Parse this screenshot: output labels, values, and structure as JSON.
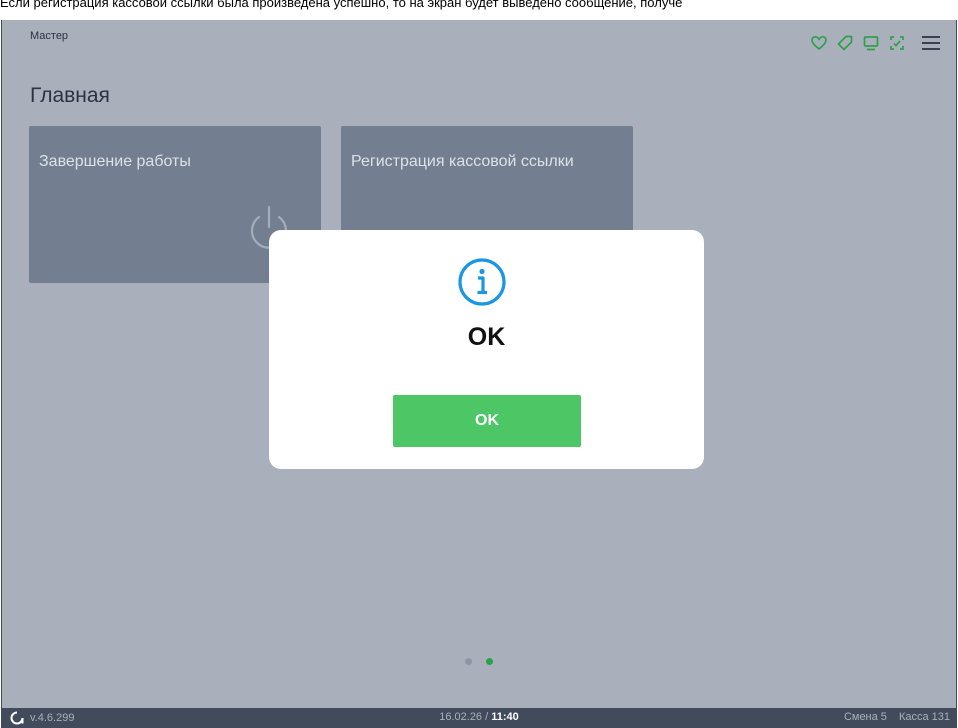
{
  "caption": "Если регистрация кассовой ссылки была произведена успешно, то на экран будет выведено сообщение, получе",
  "header": {
    "mode_label": "Мастер",
    "icons": [
      "heart-icon",
      "tag-icon",
      "monitor-icon",
      "scan-icon",
      "menu-icon"
    ],
    "icon_color": "#2fa04a"
  },
  "page": {
    "title": "Главная",
    "tiles": [
      {
        "label": "Завершение работы",
        "icon": "power-icon"
      },
      {
        "label": "Регистрация кассовой ссылки"
      }
    ],
    "pagination": {
      "total": 2,
      "current": 2
    }
  },
  "dialog": {
    "icon": "info-icon",
    "icon_color": "#1a96e6",
    "message": "OK",
    "button_label": "OK",
    "button_color": "#4dc666"
  },
  "status": {
    "version": "v.4.6.299",
    "date": "16.02.26 /",
    "time": "11:40",
    "shift": "Смена 5",
    "register": "Касса 131"
  }
}
